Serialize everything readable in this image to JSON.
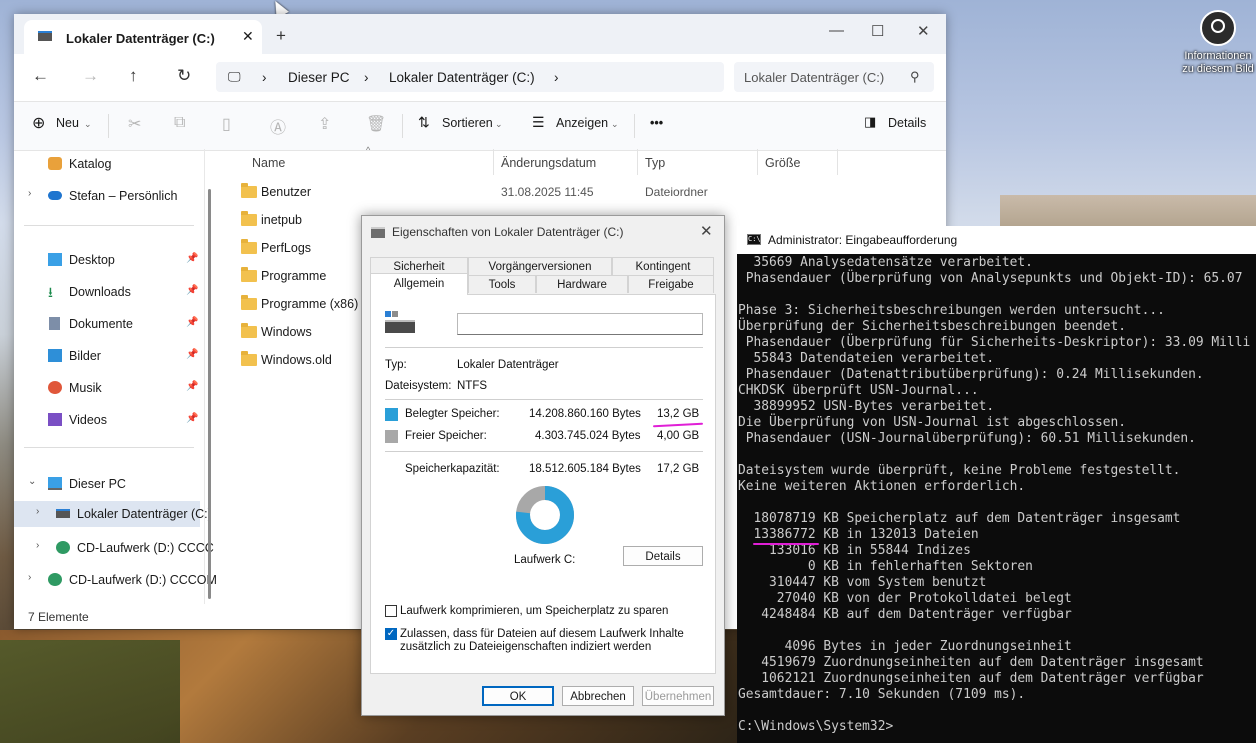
{
  "desktop": {
    "icon_label": "Informationen zu diesem Bild"
  },
  "explorer": {
    "tab_title": "Lokaler Datenträger (C:)",
    "breadcrumb": [
      "Dieser PC",
      "Lokaler Datenträger (C:)"
    ],
    "search_placeholder": "Lokaler Datenträger (C:)",
    "toolbar": {
      "new_label": "Neu",
      "sort_label": "Sortieren",
      "view_label": "Anzeigen",
      "more_label": "•••",
      "details_label": "Details"
    },
    "nav": {
      "catalog": "Katalog",
      "personal": "Stefan – Persönlich",
      "quick": [
        "Desktop",
        "Downloads",
        "Dokumente",
        "Bilder",
        "Musik",
        "Videos"
      ],
      "this_pc": "Dieser PC",
      "drive_c": "Lokaler Datenträger (C:)",
      "cd1": "CD-Laufwerk (D:) CCCC",
      "cd2": "CD-Laufwerk (D:) CCCOM"
    },
    "columns": {
      "name": "Name",
      "date": "Änderungsdatum",
      "type": "Typ",
      "size": "Größe"
    },
    "files": [
      {
        "name": "Benutzer",
        "date": "31.08.2025 11:45",
        "type": "Dateiordner"
      },
      {
        "name": "inetpub",
        "date": "",
        "type": ""
      },
      {
        "name": "PerfLogs",
        "date": "",
        "type": ""
      },
      {
        "name": "Programme",
        "date": "",
        "type": ""
      },
      {
        "name": "Programme (x86)",
        "date": "",
        "type": ""
      },
      {
        "name": "Windows",
        "date": "",
        "type": ""
      },
      {
        "name": "Windows.old",
        "date": "",
        "type": ""
      }
    ],
    "status": "7 Elemente"
  },
  "props": {
    "title": "Eigenschaften von Lokaler Datenträger (C:)",
    "tabs_row1": [
      "Sicherheit",
      "Vorgängerversionen",
      "Kontingent"
    ],
    "tabs_row2": [
      "Allgemein",
      "Tools",
      "Hardware",
      "Freigabe"
    ],
    "name_value": "",
    "type_label": "Typ:",
    "type_value": "Lokaler Datenträger",
    "fs_label": "Dateisystem:",
    "fs_value": "NTFS",
    "used_label": "Belegter Speicher:",
    "used_bytes": "14.208.860.160 Bytes",
    "used_gb": "13,2 GB",
    "free_label": "Freier Speicher:",
    "free_bytes": "4.303.745.024 Bytes",
    "free_gb": "4,00 GB",
    "cap_label": "Speicherkapazität:",
    "cap_bytes": "18.512.605.184 Bytes",
    "cap_gb": "17,2 GB",
    "used_fraction": 0.7675,
    "drive_label": "Laufwerk C:",
    "details_button": "Details",
    "compress_label": "Laufwerk komprimieren, um Speicherplatz zu sparen",
    "compress_checked": false,
    "index_label_1": "Zulassen, dass für Dateien auf diesem Laufwerk Inhalte",
    "index_label_2": "zusätzlich zu Dateieigenschaften indiziert werden",
    "index_checked": true,
    "ok": "OK",
    "cancel": "Abbrechen",
    "apply": "Übernehmen",
    "colors": {
      "used": "#2a9fd8",
      "free": "#a8a8a8"
    }
  },
  "cmd": {
    "title": "Administrator: Eingabeaufforderung",
    "lines": [
      "  35669 Analysedatensätze verarbeitet.",
      " Phasendauer (Überprüfung von Analysepunkts und Objekt-ID): 65.07",
      "",
      "Phase 3: Sicherheitsbeschreibungen werden untersucht...",
      "Überprüfung der Sicherheitsbeschreibungen beendet.",
      " Phasendauer (Überprüfung für Sicherheits-Deskriptor): 33.09 Milli",
      "  55843 Datendateien verarbeitet.",
      " Phasendauer (Datenattributüberprüfung): 0.24 Millisekunden.",
      "CHKDSK überprüft USN-Journal...",
      "  38899952 USN-Bytes verarbeitet.",
      "Die Überprüfung von USN-Journal ist abgeschlossen.",
      " Phasendauer (USN-Journalüberprüfung): 60.51 Millisekunden.",
      "",
      "Dateisystem wurde überprüft, keine Probleme festgestellt.",
      "Keine weiteren Aktionen erforderlich.",
      "",
      "  18078719 KB Speicherplatz auf dem Datenträger insgesamt",
      "  13386772 KB in 132013 Dateien",
      "    133016 KB in 55844 Indizes",
      "         0 KB in fehlerhaften Sektoren",
      "    310447 KB vom System benutzt",
      "     27040 KB von der Protokolldatei belegt",
      "   4248484 KB auf dem Datenträger verfügbar",
      "",
      "      4096 Bytes in jeder Zuordnungseinheit",
      "   4519679 Zuordnungseinheiten auf dem Datenträger insgesamt",
      "   1062121 Zuordnungseinheiten auf dem Datenträger verfügbar",
      "Gesamtdauer: 7.10 Sekunden (7109 ms).",
      "",
      "C:\\Windows\\System32>"
    ]
  },
  "highlight_color": "#e01fd6"
}
